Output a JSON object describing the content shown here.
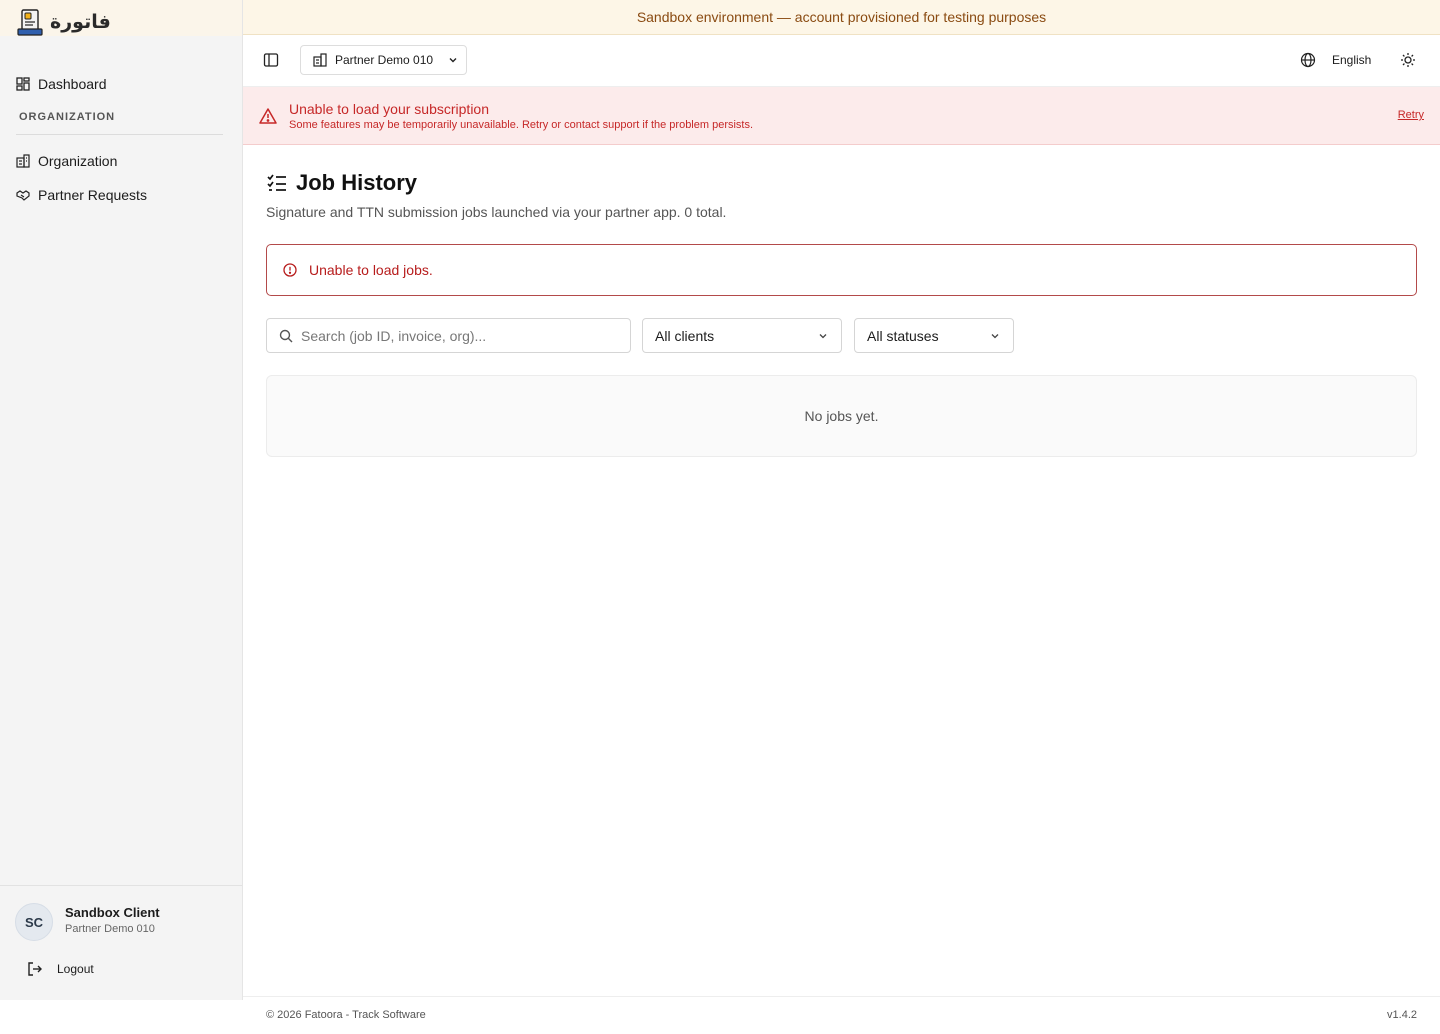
{
  "brand": {
    "name": "فاتورة"
  },
  "sidebar": {
    "items": [
      {
        "label": "Dashboard",
        "icon": "dashboard-icon"
      },
      {
        "label": "Organization",
        "icon": "building-icon"
      },
      {
        "label": "Partner Requests",
        "icon": "handshake-icon"
      }
    ],
    "section_label": "ORGANIZATION"
  },
  "user": {
    "initials": "SC",
    "name": "Sandbox Client",
    "org": "Partner Demo 010",
    "logout_label": "Logout"
  },
  "sandbox_banner": "Sandbox environment — account provisioned for testing purposes",
  "header": {
    "org_switch": "Partner Demo 010",
    "language": "English"
  },
  "subscription_error": {
    "title": "Unable to load your subscription",
    "description": "Some features may be temporarily unavailable. Retry or contact support if the problem persists.",
    "retry_label": "Retry"
  },
  "main": {
    "title": "Job History",
    "subtitle": "Signature and TTN submission jobs launched via your partner app. 0 total.",
    "error": "Unable to load jobs.",
    "search_placeholder": "Search (job ID, invoice, org)...",
    "client_filter": "All clients",
    "status_filter": "All statuses",
    "empty_text": "No jobs yet."
  },
  "footer": {
    "copyright": "© 2026 Fatoora - Track Software",
    "version": "v1.4.2"
  },
  "colors": {
    "error": "#c62828",
    "sandbox_bg": "#fdf6e7",
    "sandbox_text": "#8a4b12"
  }
}
